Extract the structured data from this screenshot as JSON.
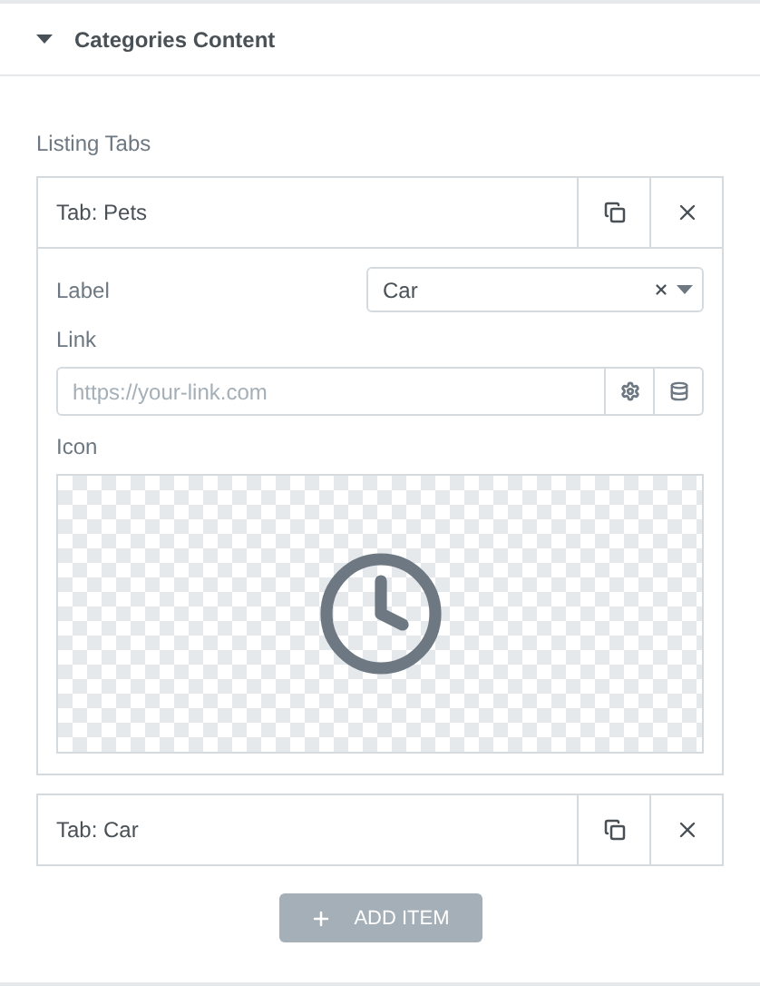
{
  "section": {
    "title": "Categories Content",
    "expanded": true
  },
  "repeater": {
    "label": "Listing Tabs",
    "items": [
      {
        "title": "Tab: Pets",
        "expanded": true,
        "fields": [
          {
            "kind": "select",
            "label": "Label",
            "value": "Car"
          },
          {
            "kind": "url",
            "label": "Link",
            "placeholder": "https://your-link.com"
          },
          {
            "kind": "icon",
            "label": "Icon"
          }
        ]
      },
      {
        "title": "Tab: Car",
        "expanded": false
      }
    ],
    "add_button": "ADD ITEM"
  }
}
